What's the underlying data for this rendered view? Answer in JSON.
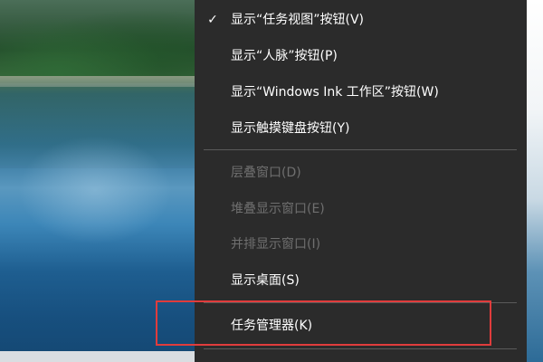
{
  "context_menu": {
    "items": [
      {
        "label": "显示“任务视图”按钮(V)",
        "checked": true,
        "enabled": true
      },
      {
        "label": "显示“人脉”按钮(P)",
        "checked": false,
        "enabled": true
      },
      {
        "label": "显示“Windows Ink 工作区”按钮(W)",
        "checked": false,
        "enabled": true
      },
      {
        "label": "显示触摸键盘按钮(Y)",
        "checked": false,
        "enabled": true
      },
      {
        "label": "层叠窗口(D)",
        "checked": false,
        "enabled": false
      },
      {
        "label": "堆叠显示窗口(E)",
        "checked": false,
        "enabled": false
      },
      {
        "label": "并排显示窗口(I)",
        "checked": false,
        "enabled": false
      },
      {
        "label": "显示桌面(S)",
        "checked": false,
        "enabled": true
      },
      {
        "label": "任务管理器(K)",
        "checked": false,
        "enabled": true
      }
    ],
    "check_glyph": "✓"
  },
  "colors": {
    "menu_background": "#2b2b2b",
    "menu_text": "#ffffff",
    "disabled_text": "#6f6f6f",
    "separator": "#5a5a5a",
    "highlight_border": "#e03c3c"
  },
  "annotation": {
    "highlighted_item": "任务管理器(K)"
  }
}
